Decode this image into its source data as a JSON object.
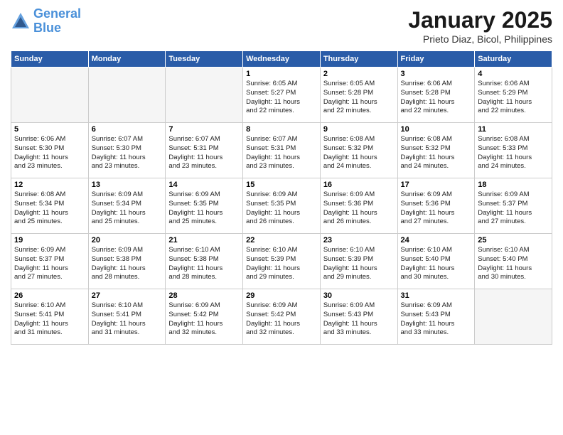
{
  "header": {
    "logo_line1": "General",
    "logo_line2": "Blue",
    "month": "January 2025",
    "location": "Prieto Diaz, Bicol, Philippines"
  },
  "days_of_week": [
    "Sunday",
    "Monday",
    "Tuesday",
    "Wednesday",
    "Thursday",
    "Friday",
    "Saturday"
  ],
  "weeks": [
    [
      {
        "day": "",
        "info": ""
      },
      {
        "day": "",
        "info": ""
      },
      {
        "day": "",
        "info": ""
      },
      {
        "day": "1",
        "info": "Sunrise: 6:05 AM\nSunset: 5:27 PM\nDaylight: 11 hours\nand 22 minutes."
      },
      {
        "day": "2",
        "info": "Sunrise: 6:05 AM\nSunset: 5:28 PM\nDaylight: 11 hours\nand 22 minutes."
      },
      {
        "day": "3",
        "info": "Sunrise: 6:06 AM\nSunset: 5:28 PM\nDaylight: 11 hours\nand 22 minutes."
      },
      {
        "day": "4",
        "info": "Sunrise: 6:06 AM\nSunset: 5:29 PM\nDaylight: 11 hours\nand 22 minutes."
      }
    ],
    [
      {
        "day": "5",
        "info": "Sunrise: 6:06 AM\nSunset: 5:30 PM\nDaylight: 11 hours\nand 23 minutes."
      },
      {
        "day": "6",
        "info": "Sunrise: 6:07 AM\nSunset: 5:30 PM\nDaylight: 11 hours\nand 23 minutes."
      },
      {
        "day": "7",
        "info": "Sunrise: 6:07 AM\nSunset: 5:31 PM\nDaylight: 11 hours\nand 23 minutes."
      },
      {
        "day": "8",
        "info": "Sunrise: 6:07 AM\nSunset: 5:31 PM\nDaylight: 11 hours\nand 23 minutes."
      },
      {
        "day": "9",
        "info": "Sunrise: 6:08 AM\nSunset: 5:32 PM\nDaylight: 11 hours\nand 24 minutes."
      },
      {
        "day": "10",
        "info": "Sunrise: 6:08 AM\nSunset: 5:32 PM\nDaylight: 11 hours\nand 24 minutes."
      },
      {
        "day": "11",
        "info": "Sunrise: 6:08 AM\nSunset: 5:33 PM\nDaylight: 11 hours\nand 24 minutes."
      }
    ],
    [
      {
        "day": "12",
        "info": "Sunrise: 6:08 AM\nSunset: 5:34 PM\nDaylight: 11 hours\nand 25 minutes."
      },
      {
        "day": "13",
        "info": "Sunrise: 6:09 AM\nSunset: 5:34 PM\nDaylight: 11 hours\nand 25 minutes."
      },
      {
        "day": "14",
        "info": "Sunrise: 6:09 AM\nSunset: 5:35 PM\nDaylight: 11 hours\nand 25 minutes."
      },
      {
        "day": "15",
        "info": "Sunrise: 6:09 AM\nSunset: 5:35 PM\nDaylight: 11 hours\nand 26 minutes."
      },
      {
        "day": "16",
        "info": "Sunrise: 6:09 AM\nSunset: 5:36 PM\nDaylight: 11 hours\nand 26 minutes."
      },
      {
        "day": "17",
        "info": "Sunrise: 6:09 AM\nSunset: 5:36 PM\nDaylight: 11 hours\nand 27 minutes."
      },
      {
        "day": "18",
        "info": "Sunrise: 6:09 AM\nSunset: 5:37 PM\nDaylight: 11 hours\nand 27 minutes."
      }
    ],
    [
      {
        "day": "19",
        "info": "Sunrise: 6:09 AM\nSunset: 5:37 PM\nDaylight: 11 hours\nand 27 minutes."
      },
      {
        "day": "20",
        "info": "Sunrise: 6:09 AM\nSunset: 5:38 PM\nDaylight: 11 hours\nand 28 minutes."
      },
      {
        "day": "21",
        "info": "Sunrise: 6:10 AM\nSunset: 5:38 PM\nDaylight: 11 hours\nand 28 minutes."
      },
      {
        "day": "22",
        "info": "Sunrise: 6:10 AM\nSunset: 5:39 PM\nDaylight: 11 hours\nand 29 minutes."
      },
      {
        "day": "23",
        "info": "Sunrise: 6:10 AM\nSunset: 5:39 PM\nDaylight: 11 hours\nand 29 minutes."
      },
      {
        "day": "24",
        "info": "Sunrise: 6:10 AM\nSunset: 5:40 PM\nDaylight: 11 hours\nand 30 minutes."
      },
      {
        "day": "25",
        "info": "Sunrise: 6:10 AM\nSunset: 5:40 PM\nDaylight: 11 hours\nand 30 minutes."
      }
    ],
    [
      {
        "day": "26",
        "info": "Sunrise: 6:10 AM\nSunset: 5:41 PM\nDaylight: 11 hours\nand 31 minutes."
      },
      {
        "day": "27",
        "info": "Sunrise: 6:10 AM\nSunset: 5:41 PM\nDaylight: 11 hours\nand 31 minutes."
      },
      {
        "day": "28",
        "info": "Sunrise: 6:09 AM\nSunset: 5:42 PM\nDaylight: 11 hours\nand 32 minutes."
      },
      {
        "day": "29",
        "info": "Sunrise: 6:09 AM\nSunset: 5:42 PM\nDaylight: 11 hours\nand 32 minutes."
      },
      {
        "day": "30",
        "info": "Sunrise: 6:09 AM\nSunset: 5:43 PM\nDaylight: 11 hours\nand 33 minutes."
      },
      {
        "day": "31",
        "info": "Sunrise: 6:09 AM\nSunset: 5:43 PM\nDaylight: 11 hours\nand 33 minutes."
      },
      {
        "day": "",
        "info": ""
      }
    ]
  ]
}
